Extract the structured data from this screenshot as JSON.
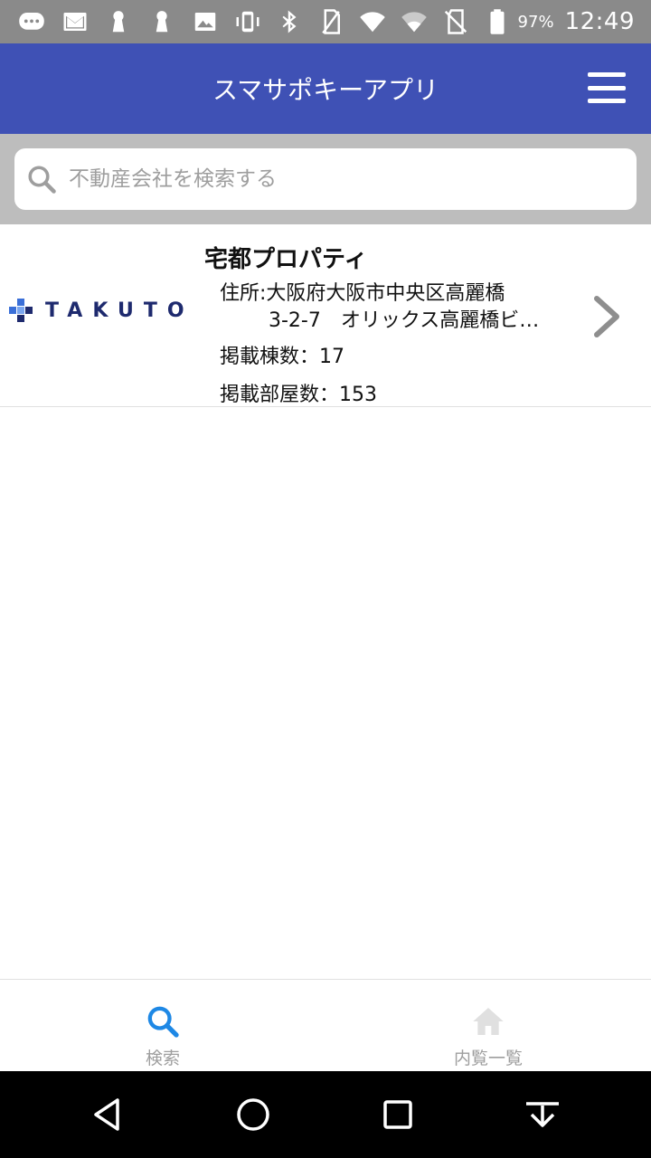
{
  "status_bar": {
    "battery_percent": "97%",
    "time": "12:49",
    "icons": [
      "chat-icon",
      "gmail-icon",
      "keyhole-icon",
      "keyhole-icon",
      "image-icon",
      "vibrate-icon",
      "bluetooth-icon",
      "no-sim-icon",
      "wifi-icon",
      "wifi-alt-icon",
      "no-sd-icon",
      "battery-icon"
    ]
  },
  "app_bar": {
    "title": "スマサポキーアプリ",
    "menu_icon": "hamburger-menu-icon",
    "color": "#3f51b5"
  },
  "search": {
    "placeholder": "不動産会社を検索する",
    "icon": "search-icon"
  },
  "results": [
    {
      "logo_text": "TAKUTO",
      "name": "宅都プロパティ",
      "address_line1": "住所:大阪府大阪市中央区高麗橋",
      "address_line2": "3-2-7　オリックス高麗橋ビ…",
      "buildings": "掲載棟数：17",
      "rooms": "掲載部屋数：153"
    }
  ],
  "bottom_nav": {
    "tabs": [
      {
        "label": "検索",
        "icon": "search-icon",
        "active": true
      },
      {
        "label": "内覧一覧",
        "icon": "home-icon",
        "active": false
      }
    ],
    "active_color": "#1e88e5",
    "inactive_color": "#bdbdbd"
  },
  "system_nav": [
    "back-icon",
    "home-circle-icon",
    "recents-icon",
    "download-icon"
  ]
}
